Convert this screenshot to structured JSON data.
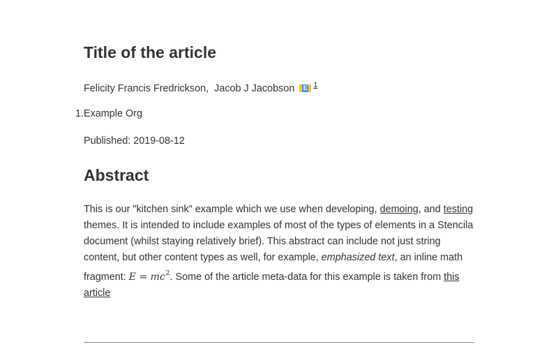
{
  "title": "Title of the article",
  "authors": [
    "Felicity Francis Fredrickson",
    "Jacob J Jacobson"
  ],
  "author_separator": ",",
  "email_icon_letter": "E",
  "affiliation_ref": "1",
  "organisations": [
    {
      "number": "1.",
      "name": "Example Org"
    }
  ],
  "published": "Published: 2019-08-12",
  "abstract_heading": "Abstract",
  "abstract": {
    "t1": "This is our \"kitchen sink\" example which we use when developing, ",
    "link_demoing": "demoing",
    "t2": ", and ",
    "link_testing": "testing",
    "t3": " themes. It is intended to include examples of most of the types of elements in a Stencila document (whilst staying relatively brief). This abstract can include not just string content, but other content types as well, for example, ",
    "emphasis": "emphasized text",
    "t4": ", an inline math fragment: ",
    "math_base": "E = mc",
    "math_exp": "2",
    "t5": ". Some of the article meta-data for this example is taken from ",
    "link_article": "this article"
  }
}
